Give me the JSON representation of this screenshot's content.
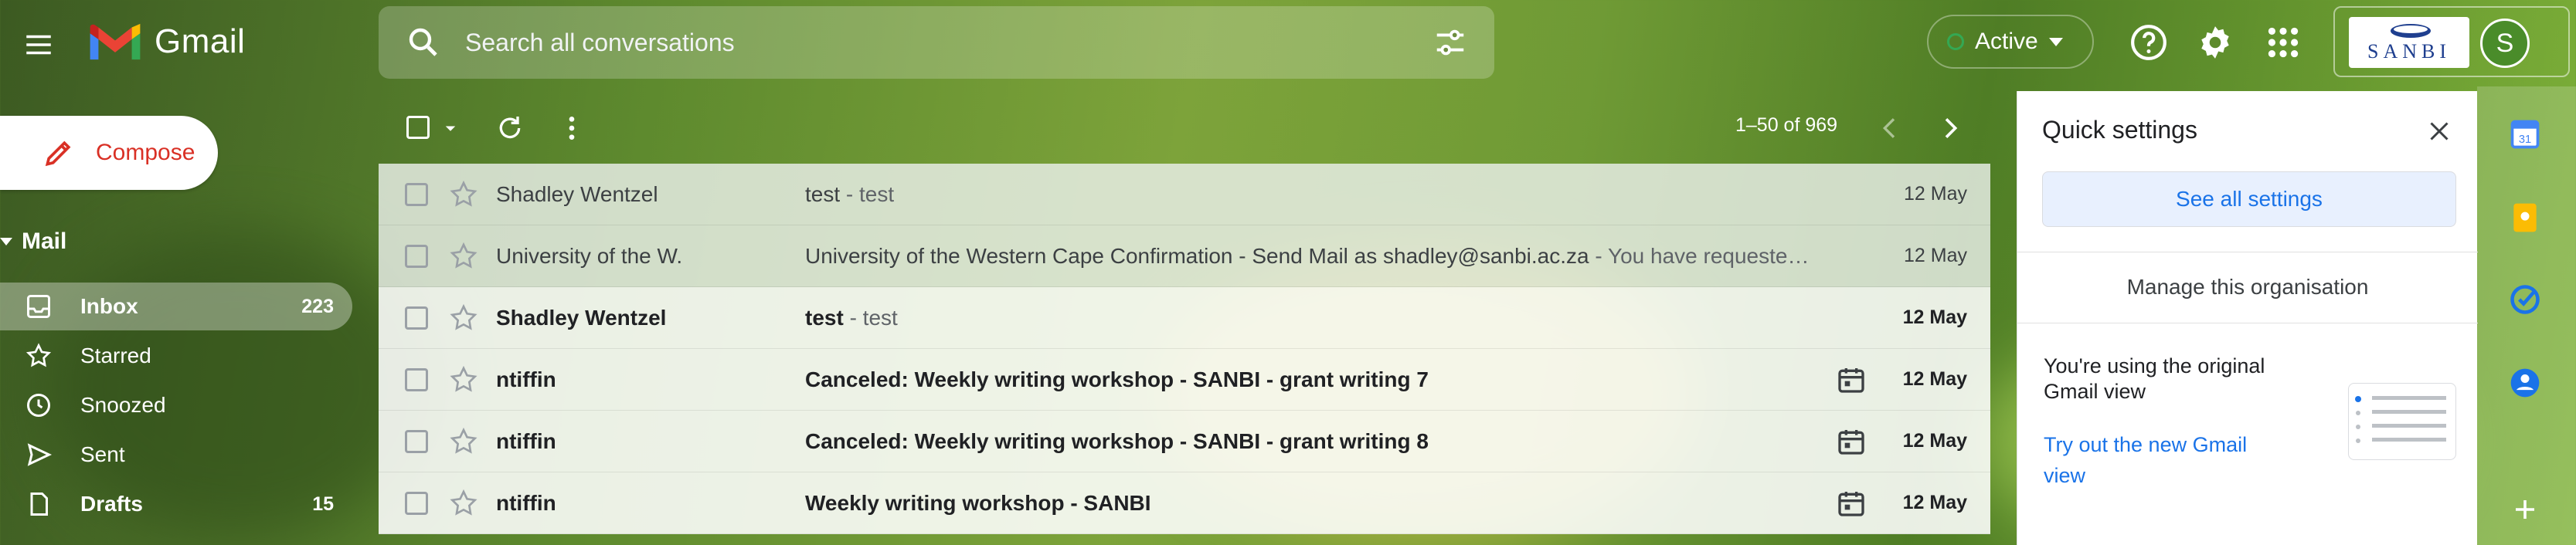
{
  "header": {
    "app_name": "Gmail",
    "search_placeholder": "Search all conversations",
    "status_label": "Active",
    "org_logo_text": "SANBI",
    "avatar_initial": "S"
  },
  "sidebar": {
    "compose_label": "Compose",
    "section_label": "Mail",
    "items": [
      {
        "label": "Inbox",
        "count": "223",
        "icon": "inbox-icon",
        "selected": true
      },
      {
        "label": "Starred",
        "count": "",
        "icon": "star-icon",
        "selected": false
      },
      {
        "label": "Snoozed",
        "count": "",
        "icon": "clock-icon",
        "selected": false
      },
      {
        "label": "Sent",
        "count": "",
        "icon": "send-icon",
        "selected": false
      },
      {
        "label": "Drafts",
        "count": "15",
        "icon": "draft-icon",
        "selected": false
      }
    ]
  },
  "toolbar": {
    "pager_text": "1–50 of 969"
  },
  "emails": [
    {
      "sender": "Shadley Wentzel",
      "subject": "test",
      "snippet": " - test",
      "date": "12 May",
      "unread": false,
      "has_invite": false
    },
    {
      "sender": "University of the W.",
      "subject": "University of the Western Cape Confirmation - Send Mail as shadley@sanbi.ac.za",
      "snippet": " - You have requeste…",
      "date": "12 May",
      "unread": false,
      "has_invite": false
    },
    {
      "sender": "Shadley Wentzel",
      "subject": "test",
      "snippet": " - test",
      "date": "12 May",
      "unread": true,
      "has_invite": false
    },
    {
      "sender": "ntiffin",
      "subject": "Canceled: Weekly writing workshop - SANBI - grant writing 7",
      "snippet": "",
      "date": "12 May",
      "unread": true,
      "has_invite": true
    },
    {
      "sender": "ntiffin",
      "subject": "Canceled: Weekly writing workshop - SANBI - grant writing 8",
      "snippet": "",
      "date": "12 May",
      "unread": true,
      "has_invite": true
    },
    {
      "sender": "ntiffin",
      "subject": "Weekly writing workshop - SANBI",
      "snippet": "",
      "date": "12 May",
      "unread": true,
      "has_invite": true
    }
  ],
  "quick_settings": {
    "title": "Quick settings",
    "see_all": "See all settings",
    "manage_org": "Manage this organisation",
    "using_text": "You're using the original Gmail view",
    "try_text": "Try out the new Gmail view"
  },
  "colors": {
    "accent_blue": "#1a73e8",
    "compose_red": "#d93025",
    "active_green": "#34a853"
  }
}
